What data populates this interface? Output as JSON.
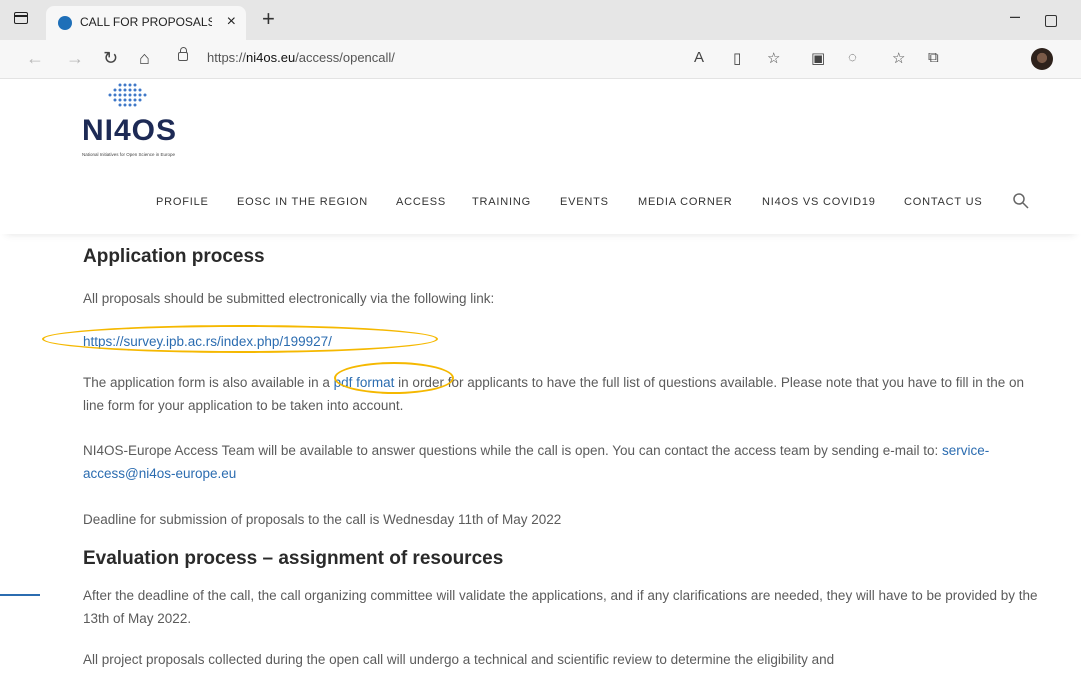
{
  "browser": {
    "tab_title": "CALL FOR PROPOSALS FOR ACCE",
    "tab_close": "×",
    "new_tab": "+",
    "url_prefix": "https://",
    "url_domain": "ni4os.eu",
    "url_path": "/access/opencall/",
    "window_min": "–"
  },
  "site": {
    "logo_text": "NI4OS",
    "logo_tagline": "National Initiatives for Open Science in Europe",
    "nav": [
      "PROFILE",
      "EOSC IN THE REGION",
      "ACCESS",
      "TRAINING",
      "EVENTS",
      "MEDIA CORNER",
      "NI4OS VS COVID19",
      "CONTACT US"
    ]
  },
  "content": {
    "app_heading": "Application process",
    "app_intro": "All proposals should be submitted electronically via the following link:",
    "survey_link": "https://survey.ipb.ac.rs/index.php/199927/",
    "form_text_1": "The application form is also available in a ",
    "pdf_link": "pdf format",
    "form_text_2": " in order for applicants to have the full list of questions available. Please note that you have to fill in the on line form for your application to be taken into account.",
    "team_text": "NI4OS-Europe Access Team will be available to answer questions while the call is open. You can contact the access team by sending e-mail to: ",
    "email_link": "service-access@ni4os-europe.eu",
    "deadline_text": "Deadline for submission of proposals to the call is Wednesday 11th of May 2022",
    "eval_heading": "Evaluation process – assignment of resources",
    "eval_text": "After the deadline of the call, the call organizing committee will validate the applications, and if any clarifications are needed, they will have to be provided by the 13th of May 2022.",
    "review_text": "All project proposals collected during the open call will undergo a technical and scientific review to determine the eligibility and"
  },
  "colors": {
    "link": "#2b6cb0",
    "highlight": "#f5b800",
    "logo": "#1d2a55"
  }
}
